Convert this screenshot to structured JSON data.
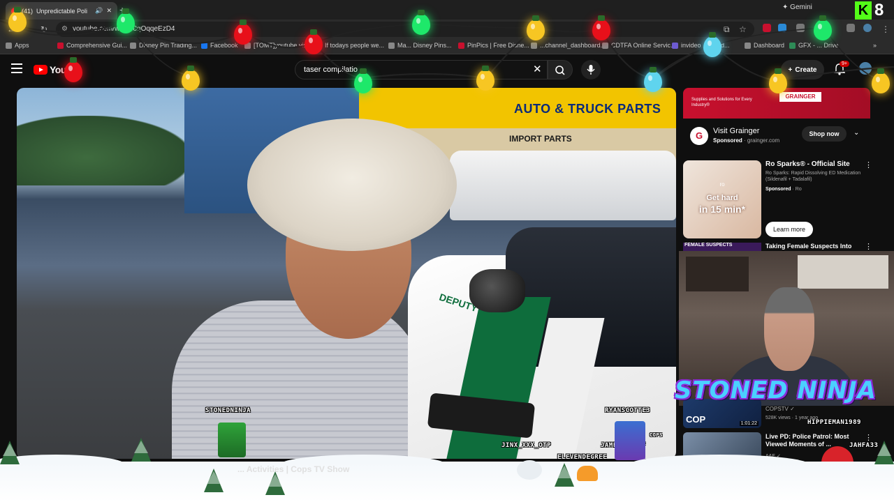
{
  "browser": {
    "tab_count_prefix": "(41)",
    "tab_title": "Unpredictable Poli",
    "url": "youtube.com/w...=n8qOqqeEzD4",
    "gemini_label": "Gemini",
    "kick_letter": "K",
    "kick_number": "8"
  },
  "bookmarks": [
    "Apps",
    "Comprehensive Gui...",
    "Disney Pin Trading...",
    "Facebook",
    "[TOMT]youtube vid...",
    "If todays people we...",
    "Ma... Disney Pins...",
    "PinPics | Free Disne...",
    "...channel_dashboard...",
    "CDTFA Online Servic...",
    "invideo",
    "id...",
    "Dashboard",
    "GFX - ... Drive"
  ],
  "youtube": {
    "logo_text": "YouT",
    "search_value": "taser compilatio",
    "create_label": "Create",
    "notification_badge": "9+"
  },
  "video": {
    "store_sign": "AUTO & TRUCK PARTS",
    "store_subsign": "IMPORT PARTS",
    "car_text": "DEPUTY",
    "overlay_names": [
      "STONEDNINJA",
      "RYANSCOTTE3",
      "JINX_XXX_OTP",
      "JAMESRYANXF",
      "ELEVENDEGREE",
      "HIPPIEMAN1989",
      "JAHFA33",
      "COPS"
    ]
  },
  "sidebar": {
    "ad_banner_text": "Supplies and Solutions for Every Industry®",
    "ad_logo": "GRAINGER",
    "ad_title": "Visit Grainger",
    "ad_sponsored": "Sponsored",
    "ad_domain": "· grainger.com",
    "ad_cta": "Shop now",
    "ro_title": "Ro Sparks® - Official Site",
    "ro_desc": "Ro Sparks: Rapid Dissolving ED Medication (Sildenafil + Tadalafil)",
    "ro_sponsored": "Sponsored",
    "ro_brand": "· Ro",
    "ro_cta": "Learn more",
    "ro_thumb_small": "ro",
    "ro_thumb_line1": "Get hard",
    "ro_thumb_line2": "in 15 min*",
    "fs_label": "FEMALE SUSPECTS",
    "fs_title": "Taking Female Suspects Into",
    "webcam_banner": "STONED NINJA",
    "cops_channel": "COPSTV",
    "cops_views": "528K views · 1 year ago",
    "cops_duration": "1:01:22",
    "cops_thumb_label": "COP",
    "live_title": "Live PD: Police Patrol: Most Viewed Moments of ...",
    "live_channel": "A&E"
  },
  "bottom_caption": "... Activities | Cops TV Show",
  "colors": {
    "accent": "#ff0000",
    "grainger_red": "#c8102e",
    "bulb_red": "#e8101a",
    "bulb_green": "#1ee86a",
    "bulb_yellow": "#f7c623",
    "bulb_blue": "#5fd4ee"
  }
}
